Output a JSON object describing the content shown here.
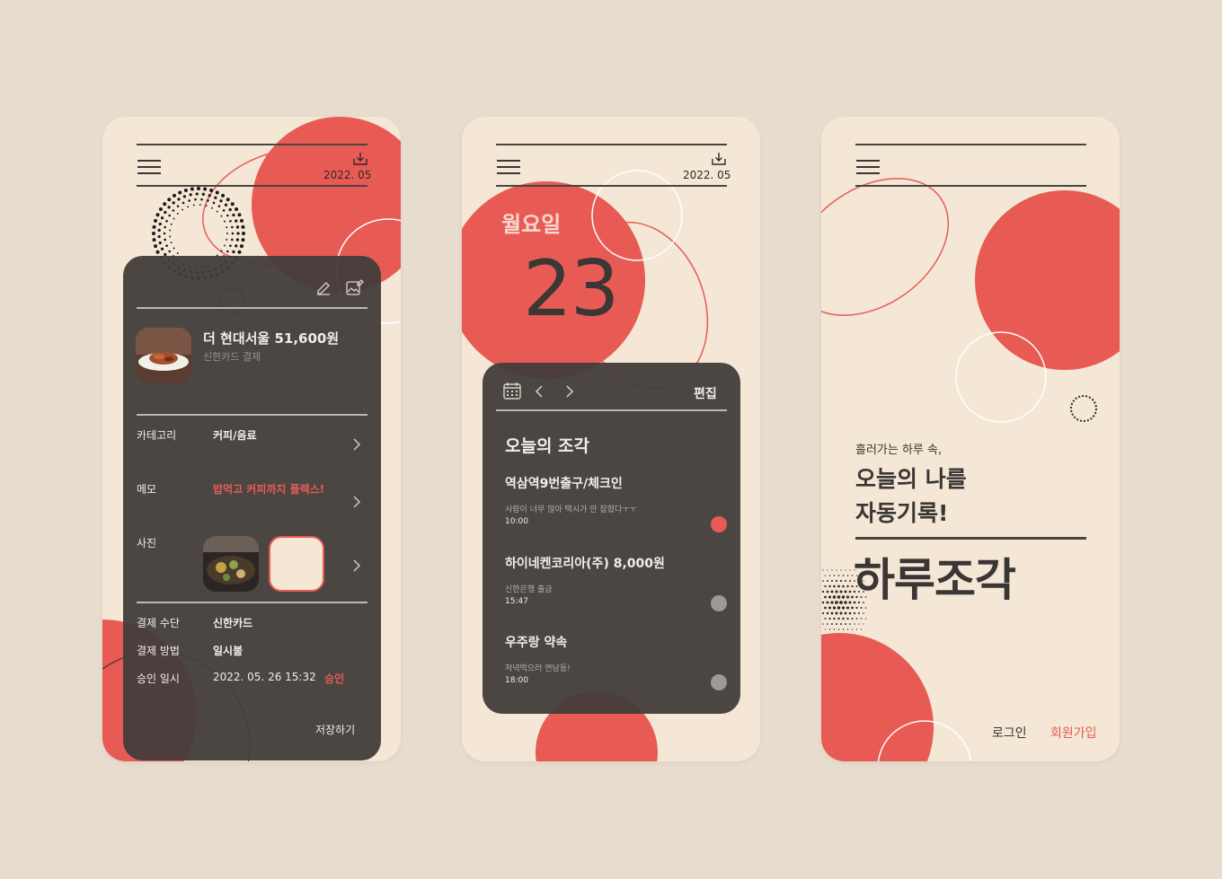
{
  "colors": {
    "background": "#e8dccf",
    "phone_bg": "#f4e7d6",
    "accent": "#e85b55",
    "panel": "#423d3b",
    "dot_gray": "#9a9a9a"
  },
  "screen1": {
    "date": "2022. 05",
    "transaction": {
      "title": "더 현대서울 51,600원",
      "subtitle": "신한카드 결제"
    },
    "category": {
      "label": "카테고리",
      "value": "커피/음료"
    },
    "memo": {
      "label": "메모",
      "value": "밥먹고 커피까지 플렉스!"
    },
    "photo": {
      "label": "사진"
    },
    "payment_method": {
      "label": "결제 수단",
      "value": "신한카드"
    },
    "payment_type": {
      "label": "결제 방법",
      "value": "일시불"
    },
    "approval": {
      "label": "승인 일시",
      "value": "2022. 05. 26 15:32",
      "status": "승인"
    },
    "save_label": "저장하기"
  },
  "screen2": {
    "date": "2022. 05",
    "weekday": "월요일",
    "day": "23",
    "edit_label": "편집",
    "section_title": "오늘의 조각",
    "items": [
      {
        "title": "역삼역9번출구/체크인",
        "detail": "사람이 너무 많아 택시가 안 잡혔다ㅜㅜ",
        "time": "10:00",
        "active": true
      },
      {
        "title": "하이네켄코리아(주) 8,000원",
        "detail": "신한은행 출금",
        "time": "15:47",
        "active": false
      },
      {
        "title": "우주랑 약속",
        "detail": "저녁먹으러 연남동!",
        "time": "18:00",
        "active": false
      }
    ]
  },
  "screen3": {
    "tagline": "흘러가는 하루 속,",
    "headline_line1": "오늘의 나를",
    "headline_line2": "자동기록!",
    "brand": "하루조각",
    "login_label": "로그인",
    "signup_label": "회원가입"
  }
}
